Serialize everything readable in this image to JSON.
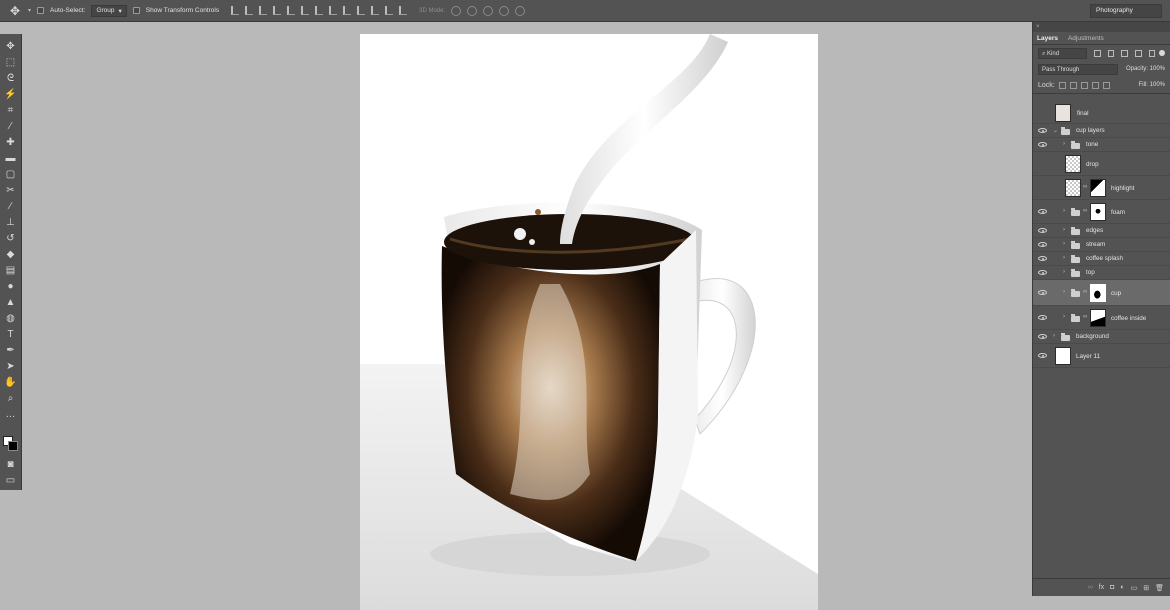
{
  "options_bar": {
    "auto_select_label": "Auto-Select:",
    "auto_select_value": "Group",
    "show_transform_label": "Show Transform Controls",
    "mode_3d_label": "3D Mode:"
  },
  "workspace": {
    "label": "Photography"
  },
  "layers_panel": {
    "tabs": [
      {
        "label": "Layers",
        "active": true
      },
      {
        "label": "Adjustments",
        "active": false
      }
    ],
    "filter_kind": "Kind",
    "blend_mode": "Pass Through",
    "opacity_label": "Opacity:",
    "opacity_value": "100%",
    "lock_label": "Lock:",
    "fill_label": "Fill:",
    "fill_value": "100%",
    "layers": [
      {
        "name": "final",
        "type": "pixel",
        "thumb": "image",
        "visible": false,
        "indent": 0
      },
      {
        "name": "cup layers",
        "type": "group",
        "expanded": true,
        "visible": true,
        "indent": 0
      },
      {
        "name": "tone",
        "type": "group",
        "expanded": false,
        "visible": true,
        "indent": 1
      },
      {
        "name": "drop",
        "type": "pixel",
        "thumb": "transparent",
        "visible": false,
        "indent": 1
      },
      {
        "name": "highlight",
        "type": "pixel",
        "thumb": "transparent",
        "mask": true,
        "visible": false,
        "indent": 1
      },
      {
        "name": "foam",
        "type": "group",
        "expanded": false,
        "mask": true,
        "visible": true,
        "indent": 1
      },
      {
        "name": "edges",
        "type": "group",
        "expanded": false,
        "visible": true,
        "indent": 1
      },
      {
        "name": "stream",
        "type": "group",
        "expanded": false,
        "visible": true,
        "indent": 1
      },
      {
        "name": "coffee splash",
        "type": "group",
        "expanded": false,
        "visible": true,
        "indent": 1
      },
      {
        "name": "top",
        "type": "group",
        "expanded": false,
        "visible": true,
        "indent": 1
      },
      {
        "name": "cup",
        "type": "group",
        "expanded": false,
        "mask": true,
        "visible": true,
        "selected": true,
        "indent": 1
      },
      {
        "name": "coffee inside",
        "type": "group",
        "expanded": false,
        "mask": true,
        "visible": true,
        "indent": 1
      },
      {
        "name": "background",
        "type": "group",
        "expanded": false,
        "visible": true,
        "indent": 0
      },
      {
        "name": "Layer 11",
        "type": "pixel",
        "thumb": "white",
        "visible": true,
        "indent": 0
      }
    ],
    "footer_icons": [
      "link-icon",
      "fx-icon",
      "mask-icon",
      "adjustment-icon",
      "folder-icon",
      "new-layer-icon",
      "trash-icon"
    ]
  },
  "toolbar": {
    "tools": [
      "move-tool",
      "marquee-tool",
      "lasso-tool",
      "magic-wand-tool",
      "crop-tool",
      "eyedropper-tool",
      "healing-tool",
      "brush-tool",
      "clone-tool",
      "history-brush-tool",
      "eraser-tool",
      "gradient-tool",
      "blur-tool",
      "dodge-tool",
      "pen-tool",
      "type-tool",
      "path-select-tool",
      "shape-tool",
      "hand-tool",
      "zoom-tool",
      "more-tools"
    ],
    "foreground_color": "#ffffff",
    "background_color": "#000000"
  },
  "colors": {
    "ui_dark": "#535353",
    "workspace_bg": "#b9b9b9",
    "selected_layer": "#6a6a6a"
  }
}
